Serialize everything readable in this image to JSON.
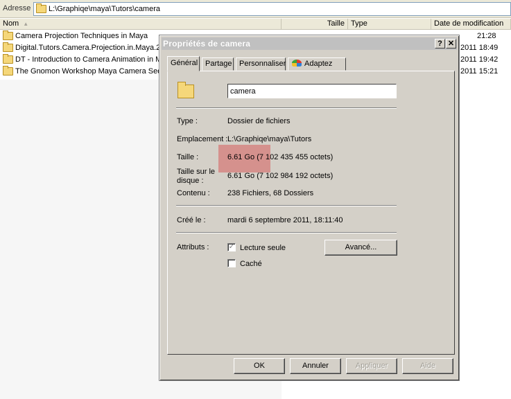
{
  "address": {
    "label": "Adresse",
    "path": "L:\\Graphiqe\\maya\\Tutors\\camera"
  },
  "columns": {
    "name": "Nom",
    "size": "Taille",
    "type": "Type",
    "date": "Date de modification"
  },
  "files": [
    {
      "name": "Camera Projection Techniques in Maya",
      "date": "21:28"
    },
    {
      "name": "Digital.Tutors.Camera.Projection.in.Maya.2",
      "date": "2011 18:49"
    },
    {
      "name": "DT - Introduction to Camera Animation in Ma",
      "date": "2011 19:42"
    },
    {
      "name": "The Gnomon Workshop Maya Camera Seque",
      "date": "2011 15:21"
    }
  ],
  "dialog": {
    "title": "Propriétés de camera",
    "help": "?",
    "close": "✕",
    "tabs": [
      {
        "label": "Général"
      },
      {
        "label": "Partage"
      },
      {
        "label": "Personnaliser"
      },
      {
        "label": "Adaptez"
      }
    ],
    "folder_name": "camera",
    "type_label": "Type :",
    "type_value": "Dossier de fichiers",
    "location_label": "Emplacement :",
    "location_value": "L:\\Graphiqe\\maya\\Tutors",
    "size_label": "Taille :",
    "size_value": "6.61 Go (7 102 435 455 octets)",
    "disk_size_label_1": "Taille sur le",
    "disk_size_label_2": "disque :",
    "disk_size_value": "6.61 Go (7 102 984 192 octets)",
    "contents_label": "Contenu :",
    "contents_value": "238 Fichiers, 68 Dossiers",
    "created_label": "Créé le :",
    "created_value": "mardi 6 septembre 2011, 18:11:40",
    "attributes_label": "Attributs :",
    "readonly_label": "Lecture seule",
    "readonly_mark": "✓",
    "hidden_label": "Caché",
    "advanced_button": "Avancé...",
    "ok_button": "OK",
    "cancel_button": "Annuler",
    "apply_button": "Appliquer",
    "help_button": "Aide"
  }
}
